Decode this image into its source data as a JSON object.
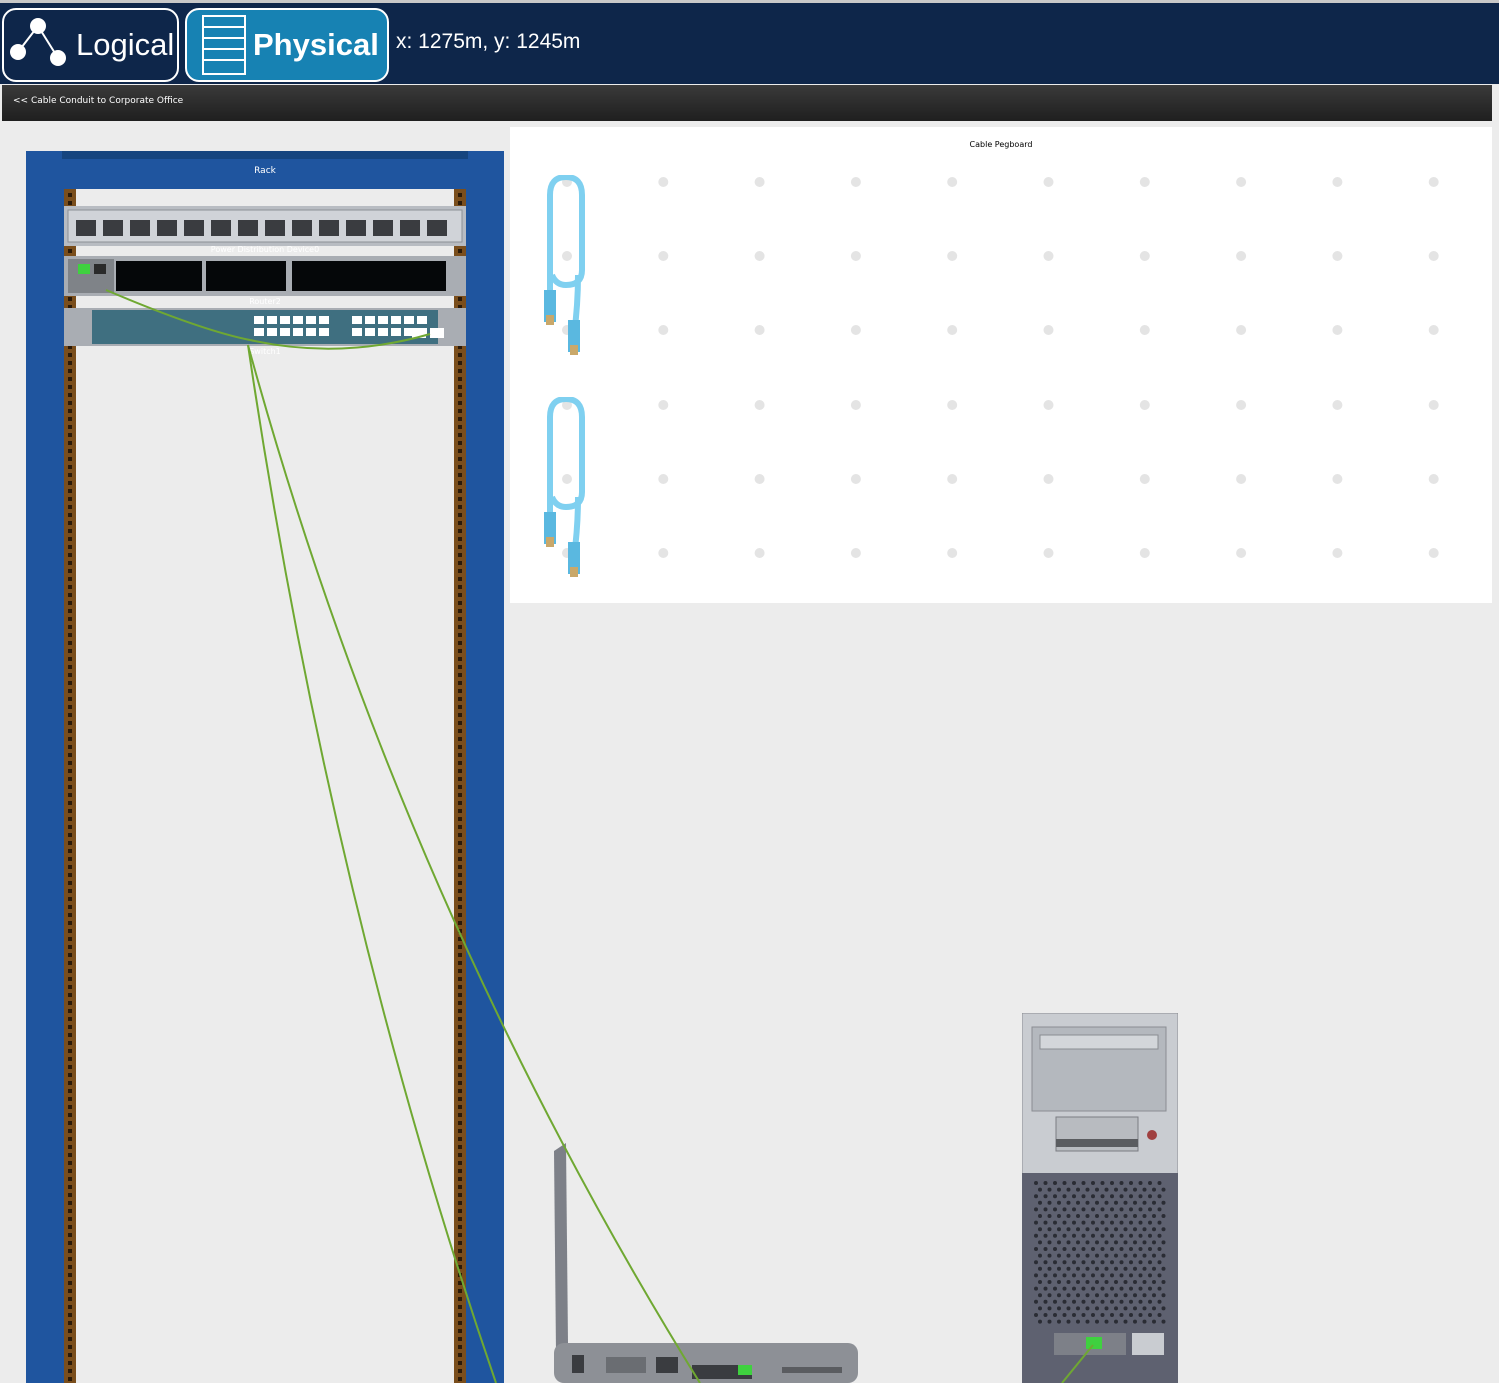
{
  "toolbar": {
    "logical_label": "Logical",
    "physical_label": "Physical",
    "coordinates": "x: 1275m, y: 1245m"
  },
  "navigation": {
    "conduit_link": "<< Cable Conduit to Corporate Office"
  },
  "rack": {
    "title": "Rack",
    "devices": [
      {
        "name": "Power Distribution Device0"
      },
      {
        "name": "Router2"
      },
      {
        "name": "Switch1"
      }
    ]
  },
  "pegboard": {
    "title": "Cable Pegboard",
    "cable_count": 2
  },
  "desk_devices": {
    "pc": "pc-tower-icon",
    "laptop": "laptop-icon"
  },
  "colors": {
    "topbar": "#0e264a",
    "active_mode": "#1782b3",
    "rack_frame": "#1f559f",
    "cable": "#6fa832",
    "pegboard_cable": "#7fd0f0"
  }
}
